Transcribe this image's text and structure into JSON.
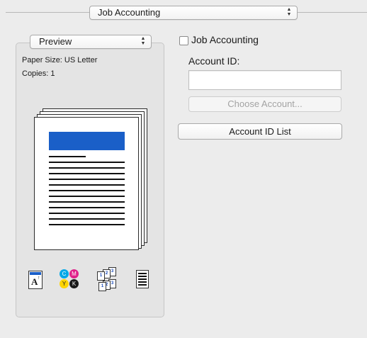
{
  "panel_menu": {
    "selected": "Job Accounting"
  },
  "preview_menu": {
    "selected": "Preview"
  },
  "preview_info": {
    "paper_size": "Paper Size: US Letter",
    "copies": "Copies: 1"
  },
  "ink_letters": {
    "cyan": "C",
    "magenta": "M",
    "yellow": "Y",
    "black": "K"
  },
  "sheet_numbers": [
    "1",
    "2",
    "3"
  ],
  "job_accounting": {
    "checkbox_label": "Job Accounting",
    "checked": false,
    "account_id_label": "Account ID:",
    "account_id_value": "",
    "choose_account_button": "Choose Account...",
    "account_id_list_button": "Account ID List"
  },
  "colors": {
    "header_band": "#1a5fc8",
    "cyan": "#00a8e8",
    "magenta": "#e0218a",
    "yellow": "#ffd400",
    "black": "#1a1a1a"
  },
  "icons": [
    "page-orientation-icon",
    "color-ink-icon",
    "multiple-pages-icon",
    "document-layout-icon"
  ]
}
